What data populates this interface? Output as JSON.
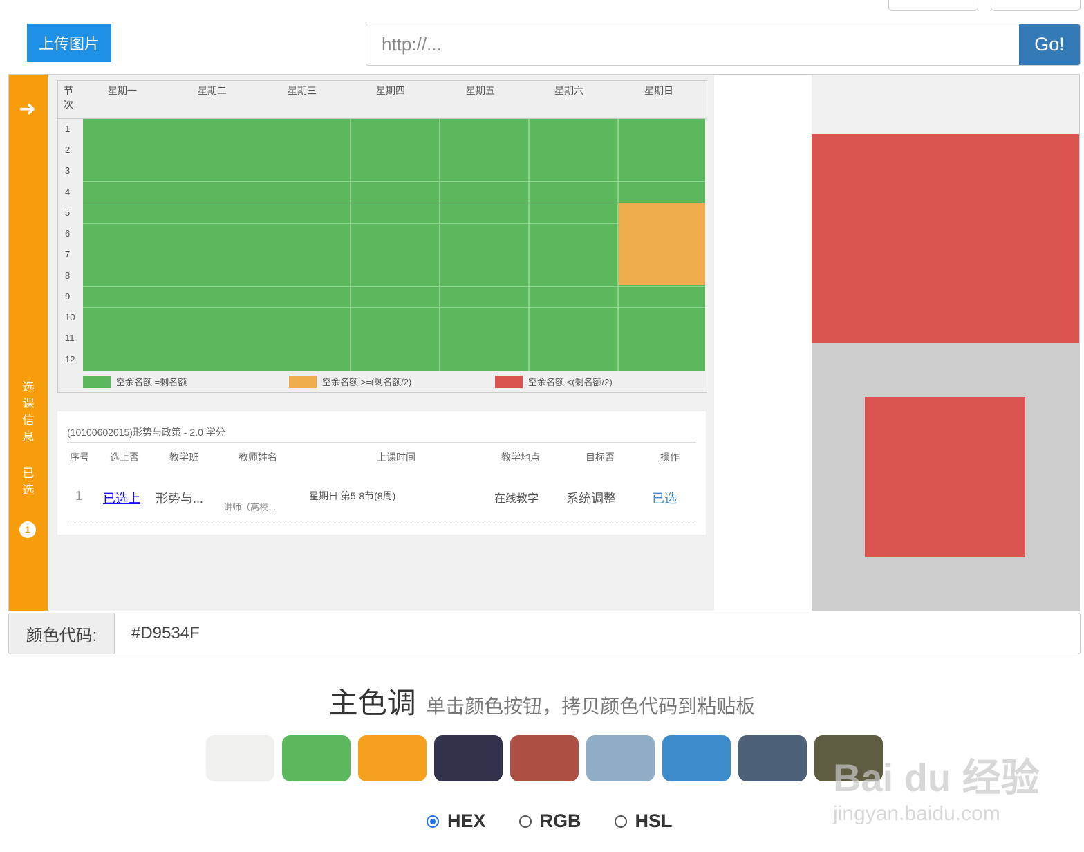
{
  "toolbar": {
    "upload_label": "上传图片",
    "url_placeholder": "http://...",
    "go_label": "Go!"
  },
  "screenshot": {
    "sidebar_vertical_1": "选课信息",
    "sidebar_vertical_2": "已选",
    "badge": "1",
    "headers": [
      "节次",
      "星期一",
      "星期二",
      "星期三",
      "星期四",
      "星期五",
      "星期六",
      "星期日"
    ],
    "rows": [
      "1",
      "2",
      "3",
      "4",
      "5",
      "6",
      "7",
      "8",
      "9",
      "10",
      "11",
      "12"
    ],
    "legend": [
      "空余名额 =剩名额",
      "空余名额 >=(剩名额/2)",
      "空余名额 <(剩名额/2)"
    ],
    "course_title": "(10100602015)形势与政策 - 2.0 学分",
    "course_cols": [
      "序号",
      "选上否",
      "教学班",
      "教师姓名",
      "上课时间",
      "教学地点",
      "目标否",
      "操作"
    ],
    "course_row": [
      "1",
      "已选上",
      "形势与...",
      "讲师（高校...",
      "星期日 第5-8节(8周)",
      "在线教学",
      "系统调整",
      "已选"
    ]
  },
  "color_code": {
    "label": "颜色代码:",
    "value": "#D9534F"
  },
  "palette_section": {
    "title": "主色调",
    "subtitle": "单击颜色按钮，拷贝颜色代码到粘贴板",
    "colors": [
      "#F0F0EE",
      "#5CB85C",
      "#F5A01E",
      "#33324D",
      "#AC5043",
      "#8FAEC6",
      "#3E8CCC",
      "#4C6177",
      "#5E5C41"
    ]
  },
  "format": {
    "options": [
      "HEX",
      "RGB",
      "HSL"
    ],
    "selected": "HEX"
  },
  "watermark": {
    "main": "Bai du 经验",
    "sub": "jingyan.baidu.com"
  }
}
